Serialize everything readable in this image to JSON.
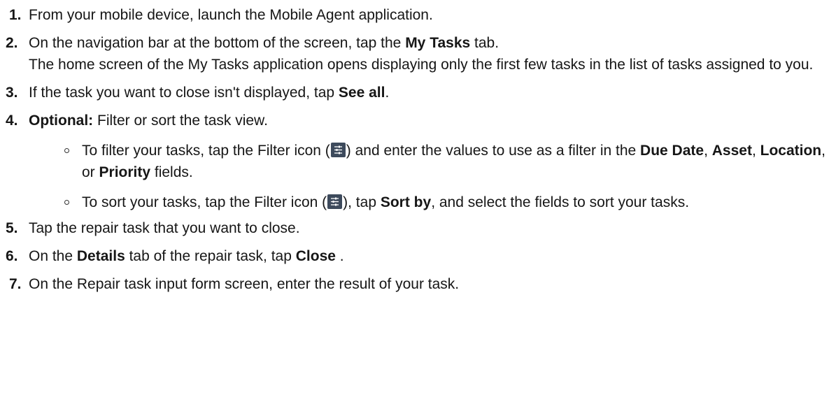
{
  "steps": [
    {
      "number": "1.",
      "text": "From your mobile device, launch the Mobile Agent application."
    },
    {
      "number": "2.",
      "text_a": "On the navigation bar at the bottom of the screen, tap the ",
      "bold": "My Tasks",
      "text_b": " tab.",
      "result": "The home screen of the My Tasks application opens displaying only the first few tasks in the list of tasks assigned to you."
    },
    {
      "number": "3.",
      "text_a": "If the task you want to close isn't displayed, tap ",
      "bold": "See all",
      "text_b": "."
    },
    {
      "number": "4.",
      "bold": "Optional:",
      "text": " Filter or sort the task view.",
      "substeps": [
        {
          "t1": "To filter your tasks, tap the Filter icon (",
          "t2": ") and enter the values to use as a filter in the ",
          "b1": "Due Date",
          "t3": ", ",
          "b2": "Asset",
          "t4": ", ",
          "b3": "Location",
          "t5": ", or ",
          "b4": "Priority",
          "t6": " fields."
        },
        {
          "t1": "To sort your tasks, tap the Filter icon (",
          "t2": "), tap ",
          "b1": "Sort by",
          "t3": ", and select the fields to sort your tasks."
        }
      ]
    },
    {
      "number": "5.",
      "text": "Tap the repair task that you want to close."
    },
    {
      "number": "6.",
      "text_a": "On the ",
      "bold1": "Details",
      "text_b": " tab of the repair task, tap ",
      "bold2": "Close",
      "text_c": " ."
    },
    {
      "number": "7.",
      "text": "On the Repair task input form screen, enter the result of your task."
    }
  ],
  "icons": {
    "filter": "filter-sliders-icon",
    "filter_bg": "#3d4a5c"
  }
}
